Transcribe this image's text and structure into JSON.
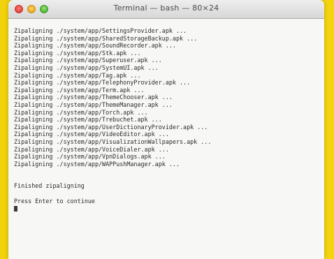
{
  "window": {
    "title": "Terminal — bash — 80×24"
  },
  "terminal": {
    "lines": [
      "Zipaligning ./system/app/SettingsProvider.apk ...",
      "Zipaligning ./system/app/SharedStorageBackup.apk ...",
      "Zipaligning ./system/app/SoundRecorder.apk ...",
      "Zipaligning ./system/app/Stk.apk ...",
      "Zipaligning ./system/app/Superuser.apk ...",
      "Zipaligning ./system/app/SystemUI.apk ...",
      "Zipaligning ./system/app/Tag.apk ...",
      "Zipaligning ./system/app/TelephonyProvider.apk ...",
      "Zipaligning ./system/app/Term.apk ...",
      "Zipaligning ./system/app/ThemeChooser.apk ...",
      "Zipaligning ./system/app/ThemeManager.apk ...",
      "Zipaligning ./system/app/Torch.apk ...",
      "Zipaligning ./system/app/Trebuchet.apk ...",
      "Zipaligning ./system/app/UserDictionaryProvider.apk ...",
      "Zipaligning ./system/app/VideoEditor.apk ...",
      "Zipaligning ./system/app/VisualizationWallpapers.apk ...",
      "Zipaligning ./system/app/VoiceDialer.apk ...",
      "Zipaligning ./system/app/VpnDialogs.apk ...",
      "Zipaligning ./system/app/WAPPushManager.apk ..."
    ],
    "finished": "Finished zipaligning",
    "prompt": "Press Enter to continue"
  },
  "colors": {
    "background": "#f4d80a",
    "terminal_bg": "#f7f7f5",
    "text": "#2a2a2a"
  }
}
